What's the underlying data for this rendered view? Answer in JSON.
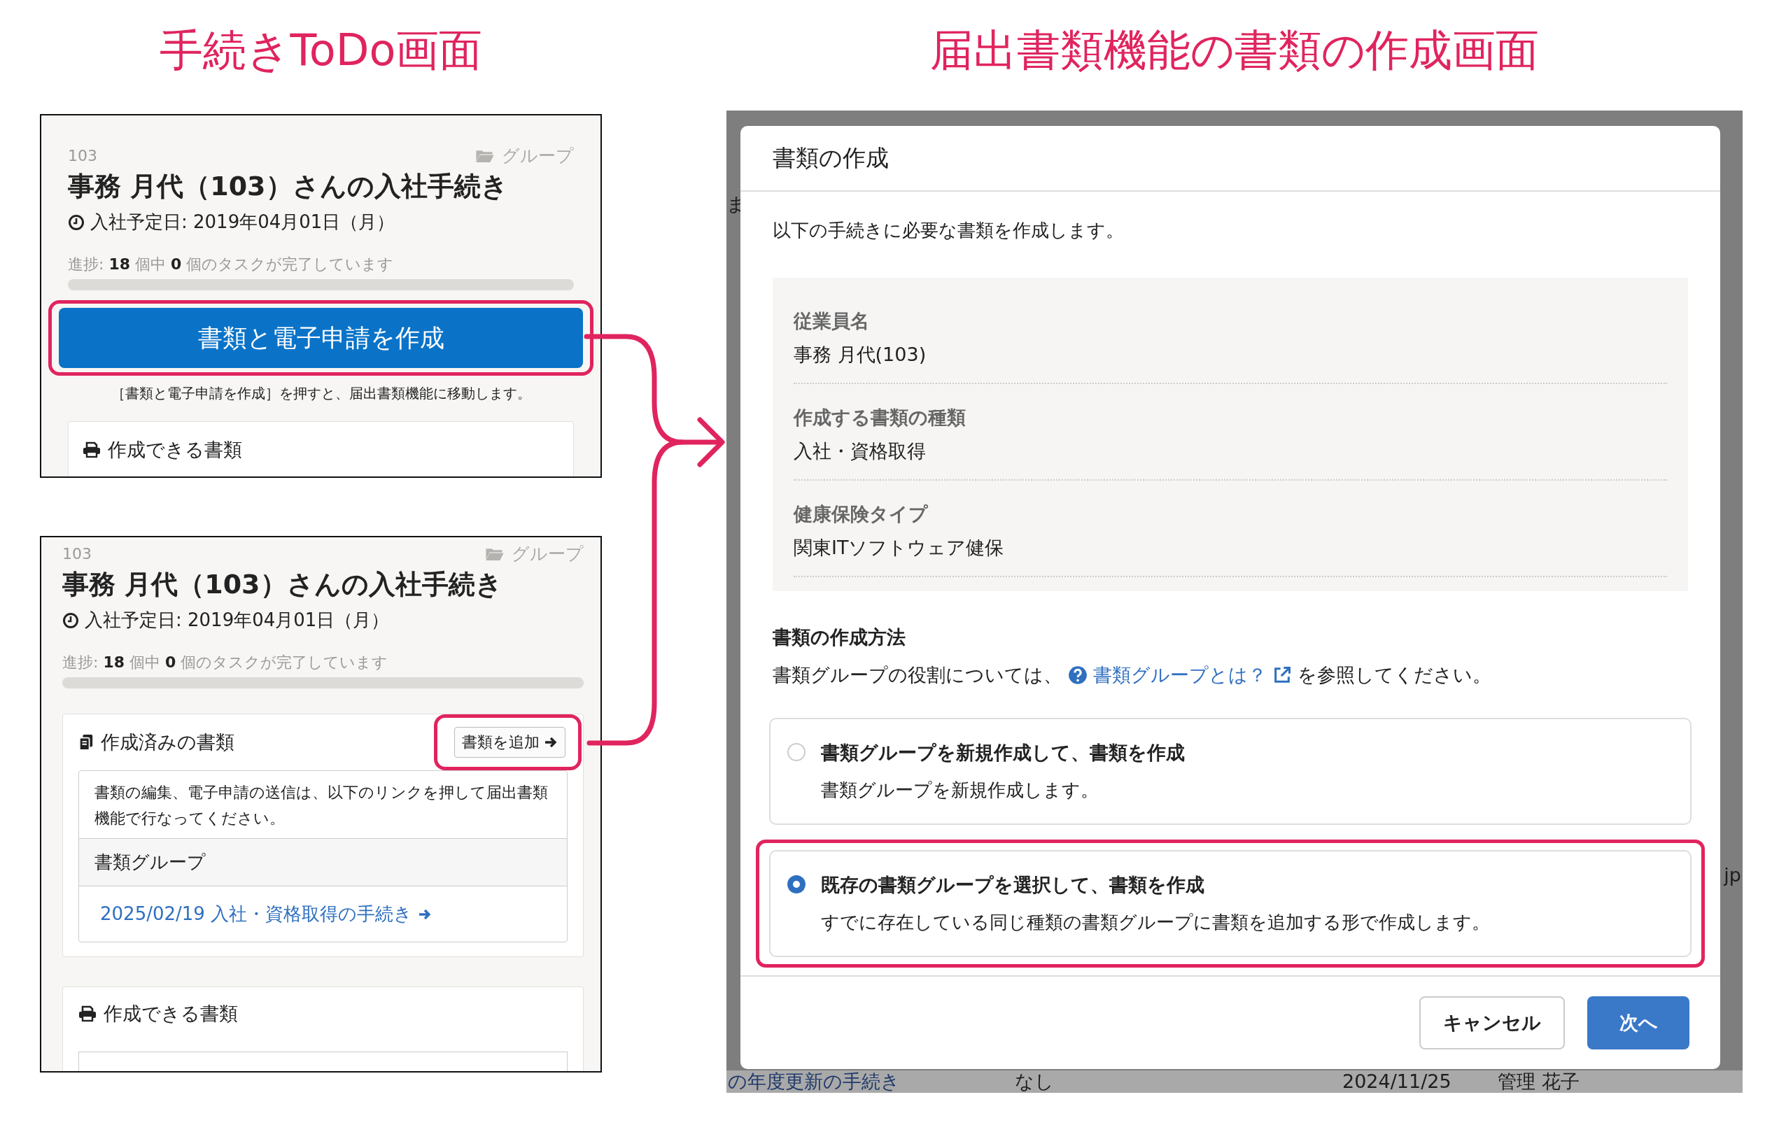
{
  "captions": [
    "手続きToDo画面",
    "届出書類機能の書類の作成画面"
  ],
  "todo_screens": [
    {
      "kind": "create",
      "number": "103",
      "group": "グループ",
      "title": "事務 月代（103）さんの入社手続き",
      "date": "入社予定日: 2019年04月01日（月）",
      "progress": "進捗: **18** 個中 **0** 個のタスクが完了しています",
      "level": 0,
      "create_button": {
        "label": "書類と電子申請を作成",
        "highlighted": true
      },
      "note": "［書類と電子申請を作成］を押すと、届出書類機能に移動します。",
      "available_docs": "作成できる書類"
    },
    {
      "kind": "created",
      "number": "103",
      "group": "グループ",
      "title": "事務 月代（103）さんの入社手続き",
      "date": "入社予定日: 2019年04月01日（月）",
      "progress": "進捗: **18** 個中 **0** 個のタスクが完了しています",
      "level": 0,
      "created_docs": {
        "title": "作成済みの書類",
        "add_button": {
          "label": "書類を追加",
          "highlighted": true
        },
        "message": "書類の編集、電子申請の送信は、以下のリンクを押して届出書類機能で行なってください。",
        "group_header": "書類グループ",
        "link": "2025/02/19 入社・資格取得の手続き"
      },
      "available_docs": "作成できる書類"
    }
  ],
  "backdrop": {
    "top_text": "ま",
    "side_text": "jp",
    "last_row": [
      "の年度更新の手続き",
      "なし",
      "2024/11/25",
      "管理 花子"
    ]
  },
  "modal": {
    "title": "書類の作成",
    "intro": "以下の手続きに必要な書類を作成します。",
    "fields": [
      {
        "label": "従業員名",
        "value": "事務 月代(103)"
      },
      {
        "label": "作成する書類の種類",
        "value": "入社・資格取得"
      },
      {
        "label": "健康保険タイプ",
        "value": "関東ITソフトウェア健保"
      }
    ],
    "method_title": "書類の作成方法",
    "help": {
      "before": "書類グループの役割については、",
      "link": "書類グループとは？",
      "after": "を参照してください。"
    },
    "options": [
      {
        "title": "書類グループを新規作成して、書類を作成",
        "description": "書類グループを新規作成します。",
        "selected": false,
        "highlighted": false
      },
      {
        "title": "既存の書類グループを選択して、書類を作成",
        "description": "すでに存在している同じ種類の書類グループに書類を追加する形で作成します。",
        "selected": true,
        "highlighted": true
      }
    ],
    "buttons": [
      {
        "label": "キャンセル",
        "kind": "secondary"
      },
      {
        "label": "次へ",
        "kind": "primary"
      }
    ]
  }
}
